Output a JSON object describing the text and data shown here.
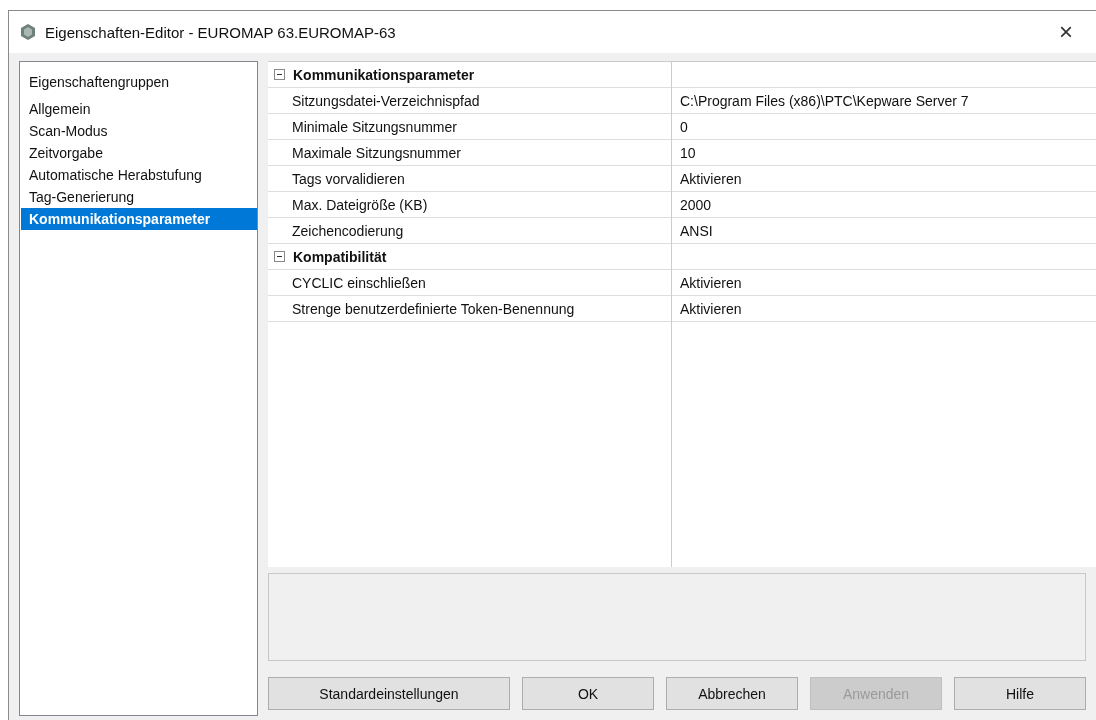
{
  "window": {
    "title": "Eigenschaften-Editor - EUROMAP 63.EUROMAP-63",
    "close": "×"
  },
  "sidebar": {
    "header": "Eigenschaftengruppen",
    "items": [
      {
        "label": "Allgemein",
        "selected": false
      },
      {
        "label": "Scan-Modus",
        "selected": false
      },
      {
        "label": "Zeitvorgabe",
        "selected": false
      },
      {
        "label": "Automatische Herabstufung",
        "selected": false
      },
      {
        "label": "Tag-Generierung",
        "selected": false
      },
      {
        "label": "Kommunikationsparameter",
        "selected": true
      }
    ]
  },
  "groups": [
    {
      "title": "Kommunikationsparameter",
      "expanded": true,
      "rows": [
        {
          "name": "Sitzungsdatei-Verzeichnispfad",
          "value": "C:\\Program Files (x86)\\PTC\\Kepware Server 7"
        },
        {
          "name": "Minimale Sitzungsnummer",
          "value": "0"
        },
        {
          "name": "Maximale Sitzungsnummer",
          "value": "10"
        },
        {
          "name": "Tags vorvalidieren",
          "value": "Aktivieren"
        },
        {
          "name": "Max. Dateigröße (KB)",
          "value": "2000"
        },
        {
          "name": "Zeichencodierung",
          "value": "ANSI"
        }
      ]
    },
    {
      "title": "Kompatibilität",
      "expanded": true,
      "rows": [
        {
          "name": "CYCLIC einschließen",
          "value": "Aktivieren"
        },
        {
          "name": "Strenge benutzerdefinierte Token-Benennung",
          "value": "Aktivieren"
        }
      ]
    }
  ],
  "buttons": [
    {
      "label": "Standardeinstellungen",
      "disabled": false
    },
    {
      "label": "OK",
      "disabled": false
    },
    {
      "label": "Abbrechen",
      "disabled": false
    },
    {
      "label": "Anwenden",
      "disabled": true
    },
    {
      "label": "Hilfe",
      "disabled": false
    }
  ]
}
